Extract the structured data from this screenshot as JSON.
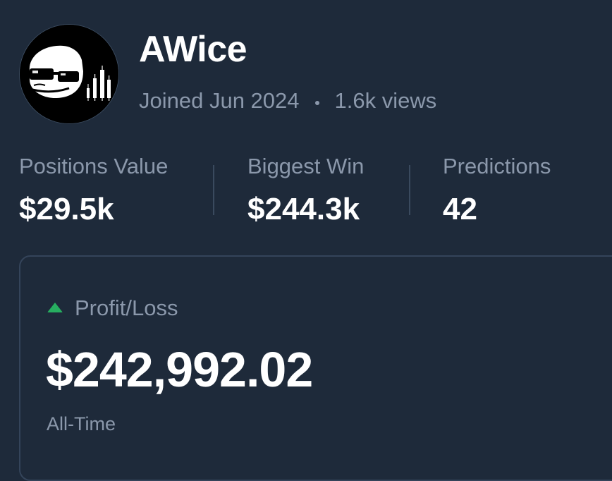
{
  "profile": {
    "username": "AWice",
    "joined": "Joined Jun 2024",
    "views": "1.6k views",
    "avatar_icon": "pepe-sunglasses-chart-avatar"
  },
  "stats": [
    {
      "label": "Positions Value",
      "value": "$29.5k"
    },
    {
      "label": "Biggest Win",
      "value": "$244.3k"
    },
    {
      "label": "Predictions",
      "value": "42"
    }
  ],
  "pnl": {
    "title": "Profit/Loss",
    "value": "$242,992.02",
    "period": "All-Time",
    "trend_icon": "triangle-up-icon",
    "trend_color": "#27ae60"
  },
  "colors": {
    "background": "#1e2a3a",
    "muted_text": "#8b98ab",
    "primary_text": "#ffffff",
    "border": "#34445a"
  }
}
